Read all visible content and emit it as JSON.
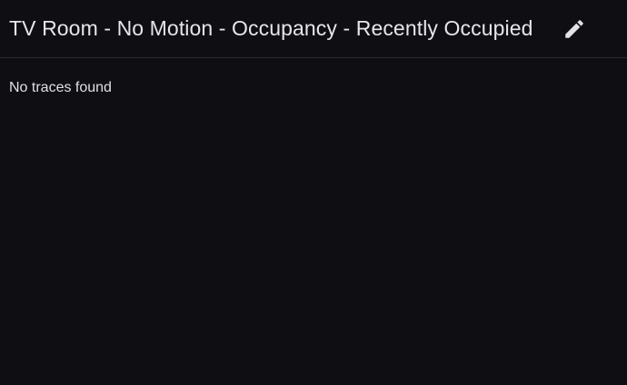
{
  "header": {
    "title": "TV Room - No Motion - Occupancy - Recently Occupied",
    "edit_icon": "pencil-icon"
  },
  "main": {
    "empty_message": "No traces found"
  },
  "colors": {
    "background": "#0f0f13",
    "text": "#e3e3e6",
    "divider": "#2b2b30",
    "icon": "#e3e3e6"
  }
}
